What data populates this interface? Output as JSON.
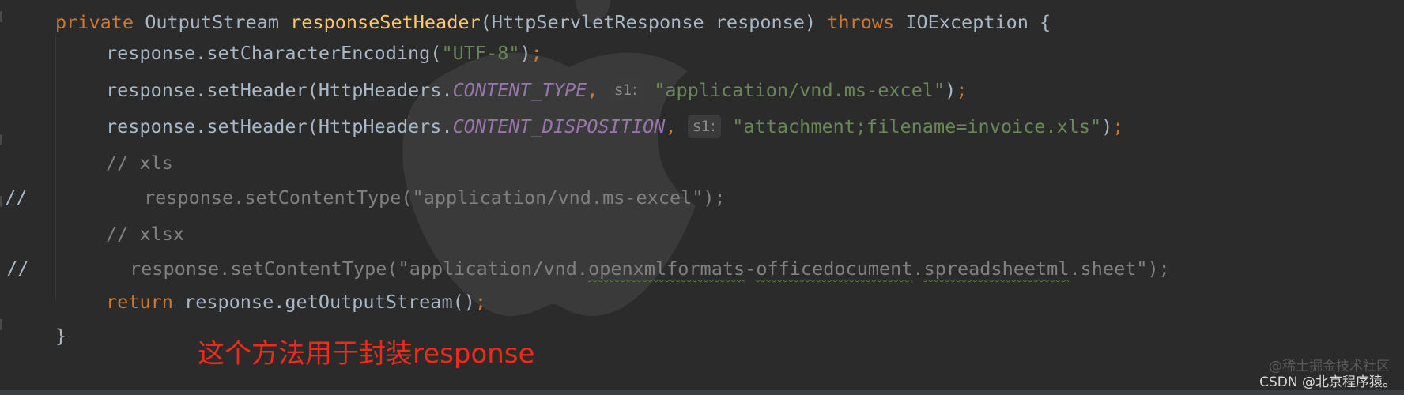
{
  "editor": {
    "background": "#2b2b2b",
    "lines": [
      [
        {
          "t": "private ",
          "c": "kw"
        },
        {
          "t": "OutputStream ",
          "c": "plain"
        },
        {
          "t": "responseSetHeader",
          "c": "fn"
        },
        {
          "t": "(HttpServletResponse response) ",
          "c": "plain"
        },
        {
          "t": "throws ",
          "c": "kw"
        },
        {
          "t": "IOException {",
          "c": "plain"
        }
      ],
      [
        {
          "t": "response.setCharacterEncoding(",
          "c": "plain"
        },
        {
          "t": "\"UTF-8\"",
          "c": "str"
        },
        {
          "t": ")",
          "c": "plain"
        },
        {
          "t": ";",
          "c": "kw"
        }
      ],
      [
        {
          "t": "response.setHeader(HttpHeaders.",
          "c": "plain"
        },
        {
          "t": "CONTENT_TYPE",
          "c": "const"
        },
        {
          "t": ", ",
          "c": "kw"
        },
        {
          "t": "s1:",
          "c": "hint"
        },
        {
          "t": " ",
          "c": "plain"
        },
        {
          "t": "\"application/vnd.ms-excel\"",
          "c": "str"
        },
        {
          "t": ")",
          "c": "plain"
        },
        {
          "t": ";",
          "c": "kw"
        }
      ],
      [
        {
          "t": "response.setHeader(HttpHeaders.",
          "c": "plain"
        },
        {
          "t": "CONTENT_DISPOSITION",
          "c": "const"
        },
        {
          "t": ", ",
          "c": "kw"
        },
        {
          "t": "s1:",
          "c": "hint"
        },
        {
          "t": " ",
          "c": "plain"
        },
        {
          "t": "\"attachment;filename=invoice.xls\"",
          "c": "str"
        },
        {
          "t": ")",
          "c": "plain"
        },
        {
          "t": ";",
          "c": "kw"
        }
      ],
      [
        {
          "t": "// xls",
          "c": "cmt"
        }
      ],
      [
        {
          "t": "response.setContentType(\"application/vnd.ms-excel\");",
          "c": "cmt"
        }
      ],
      [
        {
          "t": "// xlsx",
          "c": "cmt"
        }
      ],
      [
        {
          "t": "response.setContentType(\"application/vnd.",
          "c": "cmt"
        },
        {
          "t": "openxmlformats",
          "c": "cmt sq"
        },
        {
          "t": "-",
          "c": "cmt"
        },
        {
          "t": "officedocument",
          "c": "cmt sq"
        },
        {
          "t": ".",
          "c": "cmt"
        },
        {
          "t": "spreadsheetml",
          "c": "cmt sq"
        },
        {
          "t": ".sheet\");",
          "c": "cmt"
        }
      ],
      [
        {
          "t": "return ",
          "c": "kw"
        },
        {
          "t": "response.getOutputStream()",
          "c": "plain"
        },
        {
          "t": ";",
          "c": "kw"
        }
      ],
      [
        {
          "t": "}",
          "c": "plain"
        }
      ]
    ],
    "gutter_comment_marks": [
      "//",
      "//"
    ]
  },
  "annotation": {
    "text": "这个方法用于封装response",
    "color": "#ee2a1c"
  },
  "credits": {
    "main": "CSDN @北京程序猿。",
    "faint": "@稀土掘金技术社区"
  }
}
